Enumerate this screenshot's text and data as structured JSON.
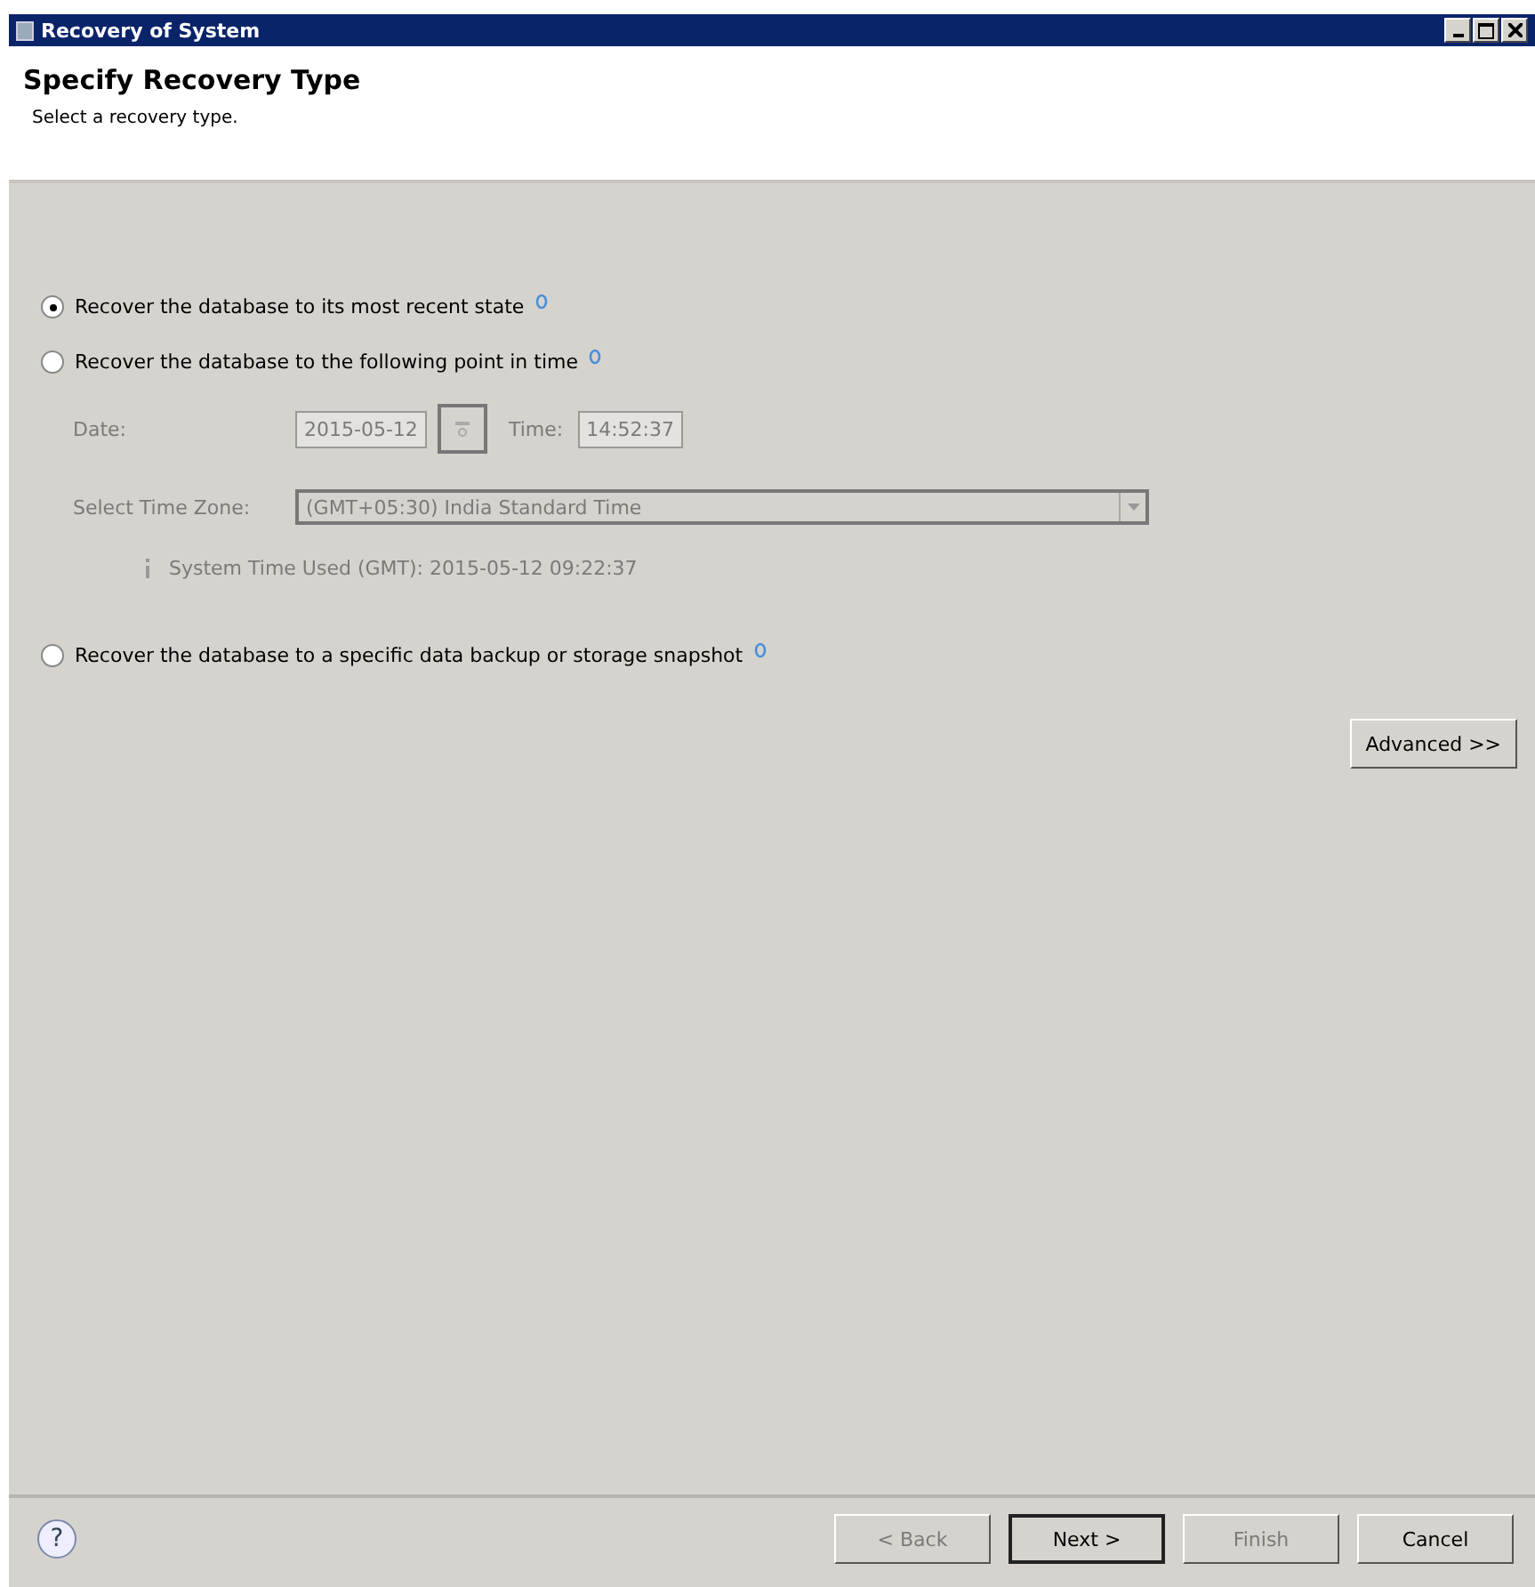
{
  "window": {
    "title": "Recovery of System"
  },
  "header": {
    "title": "Specify Recovery Type",
    "subtitle": "Select a recovery type."
  },
  "options": [
    {
      "label": "Recover the database to its most recent state",
      "selected": true
    },
    {
      "label": "Recover the database to the following point in time",
      "selected": false
    },
    {
      "label": "Recover the database to a specific data backup or storage snapshot",
      "selected": false
    }
  ],
  "point_in_time": {
    "disabled": true,
    "date_label": "Date:",
    "date": "2015-05-12",
    "time_label": "Time:",
    "time": "14:52:37",
    "zone_label": "Select Time Zone:",
    "zone": "(GMT+05:30) India Standard Time",
    "info": "System Time Used (GMT): 2015-05-12 09:22:37"
  },
  "advanced_button": "Advanced >>",
  "help_button": "?",
  "buttons": [
    {
      "label": "< Back",
      "disabled": true,
      "default": false
    },
    {
      "label": "Next >",
      "disabled": false,
      "default": true
    },
    {
      "label": "Finish",
      "disabled": true,
      "default": false
    },
    {
      "label": "Cancel",
      "disabled": false,
      "default": false
    }
  ]
}
